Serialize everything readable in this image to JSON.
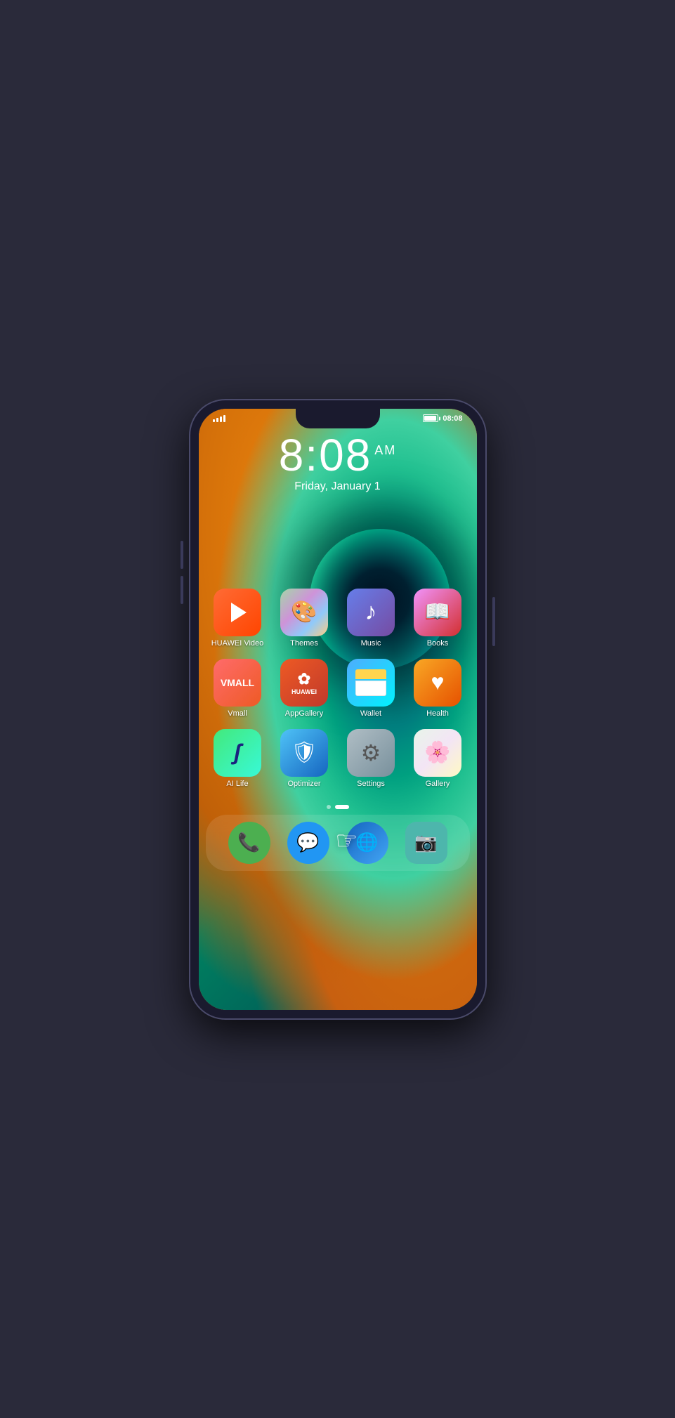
{
  "status": {
    "time": "08:08",
    "battery_label": "08:08",
    "signal_bars": 4
  },
  "clock": {
    "hour": "8",
    "colon": ":",
    "minute": "08",
    "ampm": "AM",
    "date": "Friday, January 1"
  },
  "apps_row1": [
    {
      "id": "huawei-video",
      "label": "HUAWEI Video",
      "icon_type": "video"
    },
    {
      "id": "themes",
      "label": "Themes",
      "icon_type": "themes"
    },
    {
      "id": "music",
      "label": "Music",
      "icon_type": "music"
    },
    {
      "id": "books",
      "label": "Books",
      "icon_type": "books"
    }
  ],
  "apps_row2": [
    {
      "id": "vmall",
      "label": "Vmall",
      "icon_type": "vmall"
    },
    {
      "id": "appgallery",
      "label": "AppGallery",
      "icon_type": "appgallery"
    },
    {
      "id": "wallet",
      "label": "Wallet",
      "icon_type": "wallet"
    },
    {
      "id": "health",
      "label": "Health",
      "icon_type": "health"
    }
  ],
  "apps_row3": [
    {
      "id": "ai-life",
      "label": "AI Life",
      "icon_type": "ailife"
    },
    {
      "id": "optimizer",
      "label": "Optimizer",
      "icon_type": "optimizer"
    },
    {
      "id": "settings",
      "label": "Settings",
      "icon_type": "settings"
    },
    {
      "id": "gallery",
      "label": "Gallery",
      "icon_type": "gallery"
    }
  ],
  "dock": [
    {
      "id": "phone",
      "label": "Phone",
      "icon_type": "phone"
    },
    {
      "id": "messages",
      "label": "Messages",
      "icon_type": "messages"
    },
    {
      "id": "browser",
      "label": "Browser",
      "icon_type": "browser"
    },
    {
      "id": "camera",
      "label": "Camera",
      "icon_type": "camera"
    }
  ],
  "page_indicators": [
    {
      "active": false
    },
    {
      "active": true
    }
  ]
}
